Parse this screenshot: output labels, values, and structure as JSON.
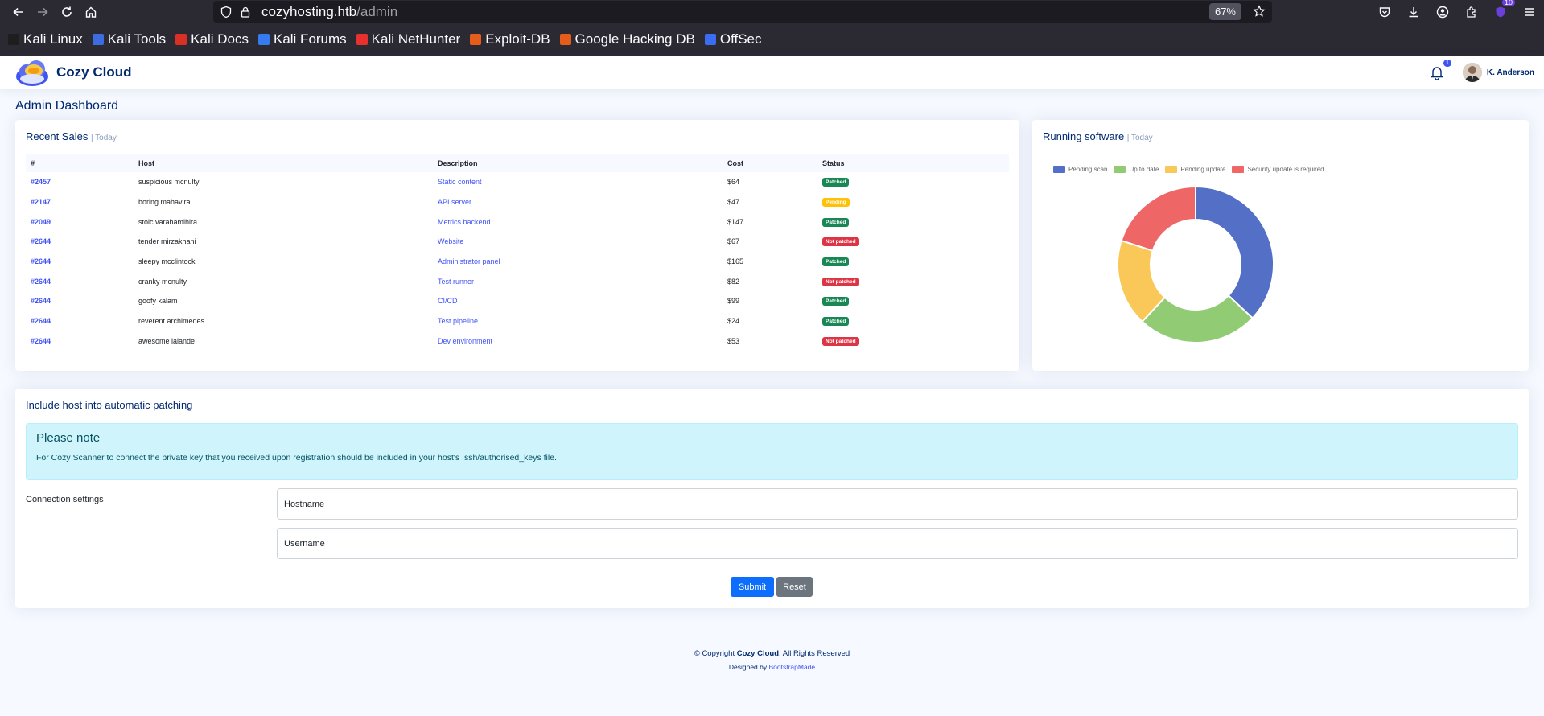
{
  "browser": {
    "url_host": "cozyhosting.htb",
    "url_path": "/admin",
    "zoom": "67%",
    "ext_badge": "10",
    "bookmarks": [
      {
        "label": "Kali Linux",
        "color": "#1e1e1e"
      },
      {
        "label": "Kali Tools",
        "color": "#3d6be0"
      },
      {
        "label": "Kali Docs",
        "color": "#d93025"
      },
      {
        "label": "Kali Forums",
        "color": "#367bf0"
      },
      {
        "label": "Kali NetHunter",
        "color": "#e8312f"
      },
      {
        "label": "Exploit-DB",
        "color": "#e65c1a"
      },
      {
        "label": "Google Hacking DB",
        "color": "#e65c1a"
      },
      {
        "label": "OffSec",
        "color": "#3b6df2"
      }
    ]
  },
  "header": {
    "brand": "Cozy Cloud",
    "notification_count": "1",
    "user_name": "K. Anderson"
  },
  "page_title": "Admin Dashboard",
  "sales": {
    "title": "Recent Sales",
    "subtitle": "| Today",
    "columns": [
      "#",
      "Host",
      "Description",
      "Cost",
      "Status"
    ],
    "rows": [
      {
        "id": "#2457",
        "host": "suspicious mcnulty",
        "desc": "Static content",
        "cost": "$64",
        "status": "Patched",
        "kind": "green"
      },
      {
        "id": "#2147",
        "host": "boring mahavira",
        "desc": "API server",
        "cost": "$47",
        "status": "Pending",
        "kind": "yellow"
      },
      {
        "id": "#2049",
        "host": "stoic varahamihira",
        "desc": "Metrics backend",
        "cost": "$147",
        "status": "Patched",
        "kind": "green"
      },
      {
        "id": "#2644",
        "host": "tender mirzakhani",
        "desc": "Website",
        "cost": "$67",
        "status": "Not patched",
        "kind": "red"
      },
      {
        "id": "#2644",
        "host": "sleepy mcclintock",
        "desc": "Administrator panel",
        "cost": "$165",
        "status": "Patched",
        "kind": "green"
      },
      {
        "id": "#2644",
        "host": "cranky mcnulty",
        "desc": "Test runner",
        "cost": "$82",
        "status": "Not patched",
        "kind": "red"
      },
      {
        "id": "#2644",
        "host": "goofy kalam",
        "desc": "CI/CD",
        "cost": "$99",
        "status": "Patched",
        "kind": "green"
      },
      {
        "id": "#2644",
        "host": "reverent archimedes",
        "desc": "Test pipeline",
        "cost": "$24",
        "status": "Patched",
        "kind": "green"
      },
      {
        "id": "#2644",
        "host": "awesome lalande",
        "desc": "Dev environment",
        "cost": "$53",
        "status": "Not patched",
        "kind": "red"
      }
    ]
  },
  "software": {
    "title": "Running software",
    "subtitle": "| Today"
  },
  "chart_data": {
    "type": "pie",
    "donut": true,
    "categories": [
      "Pending scan",
      "Up to date",
      "Pending update",
      "Security update is required"
    ],
    "values": [
      37,
      25,
      18,
      20
    ],
    "colors": [
      "#5470c6",
      "#91cc75",
      "#fac858",
      "#ee6666"
    ],
    "legend": "top"
  },
  "patch": {
    "title": "Include host into automatic patching",
    "alert_heading": "Please note",
    "alert_text": "For Cozy Scanner to connect the private key that you received upon registration should be included in your host's .ssh/authorised_keys file.",
    "connection_label": "Connection settings",
    "hostname_placeholder": "Hostname",
    "username_placeholder": "Username",
    "submit_label": "Submit",
    "reset_label": "Reset"
  },
  "footer": {
    "prefix": "© Copyright ",
    "brand": "Cozy Cloud",
    "suffix": ". All Rights Reserved",
    "designed_by": "Designed by ",
    "designer": "BootstrapMade"
  }
}
